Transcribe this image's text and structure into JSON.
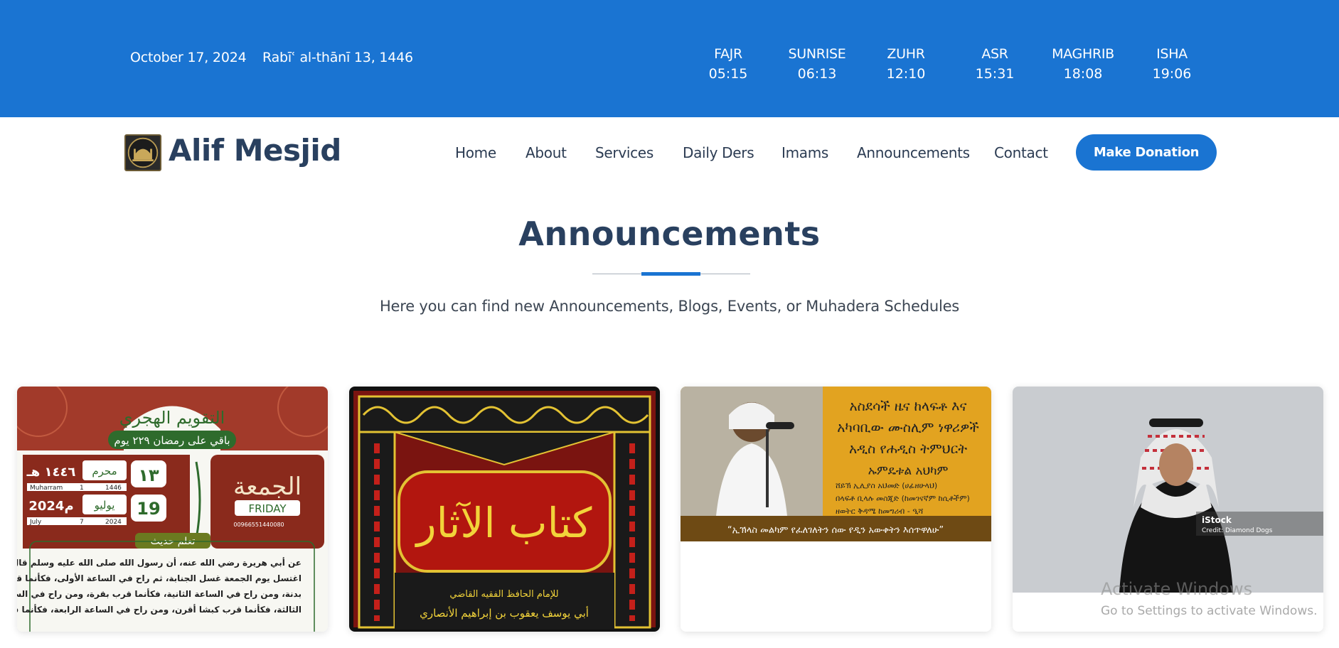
{
  "topbar": {
    "gregorian_date": "October 17, 2024",
    "hijri_date": "Rabīʿ al-thānī 13, 1446",
    "prayers": [
      {
        "name": "FAJR",
        "time": "05:15"
      },
      {
        "name": "SUNRISE",
        "time": "06:13"
      },
      {
        "name": "ZUHR",
        "time": "12:10"
      },
      {
        "name": "ASR",
        "time": "15:31"
      },
      {
        "name": "MAGHRIB",
        "time": "18:08"
      },
      {
        "name": "ISHA",
        "time": "19:06"
      }
    ]
  },
  "nav": {
    "brand": "Alif Mesjid",
    "links": [
      "Home",
      "About",
      "Services",
      "Daily Ders",
      "Imams",
      "Announcements",
      "Contact"
    ],
    "donate_label": "Make Donation"
  },
  "section": {
    "title": "Announcements",
    "subtitle": "Here you can find new Announcements, Blogs, Events, or Muhadera Schedules"
  },
  "cards": [
    {
      "kind": "hijri-calendar-poster",
      "header": "التقويم الهجري",
      "countdown": "باقي على رمضان ٢٢٩ يوم",
      "hijri_day": "١٣",
      "hijri_month": "محرم",
      "hijri_year": "١٤٤٦ هـ",
      "hijri_latin": [
        "Muharram",
        "1",
        "1446"
      ],
      "greg_day": "19",
      "greg_month": "يوليو",
      "greg_year": "2024م",
      "greg_latin": [
        "July",
        "7",
        "2024"
      ],
      "weekday_ar": "الجمعة",
      "weekday": "FRIDAY",
      "phone": "00966551440080",
      "hadith_label": "تعلم حديث",
      "hadith_lines": [
        "عن أبي هريرة رضي الله عنه، أن رسول الله صلى الله عليه وسلم قال: \" من",
        "اغتسل يوم الجمعة غسل الجنابة، ثم راح في الساعة الأولى، فكأنما قرب",
        "بدنة، ومن راح في الساعة الثانية، فكأنما قرب بقرة، ومن راح في الساعة",
        "الثالثة، فكأنما قرب كبشا أقرن، ومن راح في الساعة الرابعة، فكأنما قرب"
      ]
    },
    {
      "kind": "book-cover",
      "title_ar": "كتاب الآثار",
      "lines": [
        "للإمام الحافظ الفقيه القاضي",
        "أبي يوسف يعقوب بن إبراهيم الأنصاري"
      ]
    },
    {
      "kind": "amharic-lecture-poster",
      "lines": [
        "አስደሳች ዜና ከላፍቶ እና",
        "አካባቢው ሙስሊም ነዋሪዎች",
        "አዲስ የሐዲስ ትምህርት",
        "ኡምዴቱል አህካም"
      ],
      "items": [
        "ሸይኽ ኢሊያስ አህመድ (ሀፊዘሁላህ)",
        "በላፍቶ ቢላሉ መስጂድ (ከመገናኛም ከሲቶችም)",
        "ዘወትር ቅዳሜ ከመግሪብ - ዒሻ"
      ],
      "footer": "“ኢኽላስ መልካም የፈለገለትን ሰው የዲን አውቀትን እሰጥዋለሁ”"
    },
    {
      "kind": "stock-photo",
      "brand": "iStock",
      "credit": "Credit: Diamond Dogs"
    }
  ],
  "watermark": {
    "line1": "Activate Windows",
    "line2": "Go to Settings to activate Windows."
  },
  "colors": {
    "primary": "#1a74d2",
    "heading": "#29405f"
  }
}
